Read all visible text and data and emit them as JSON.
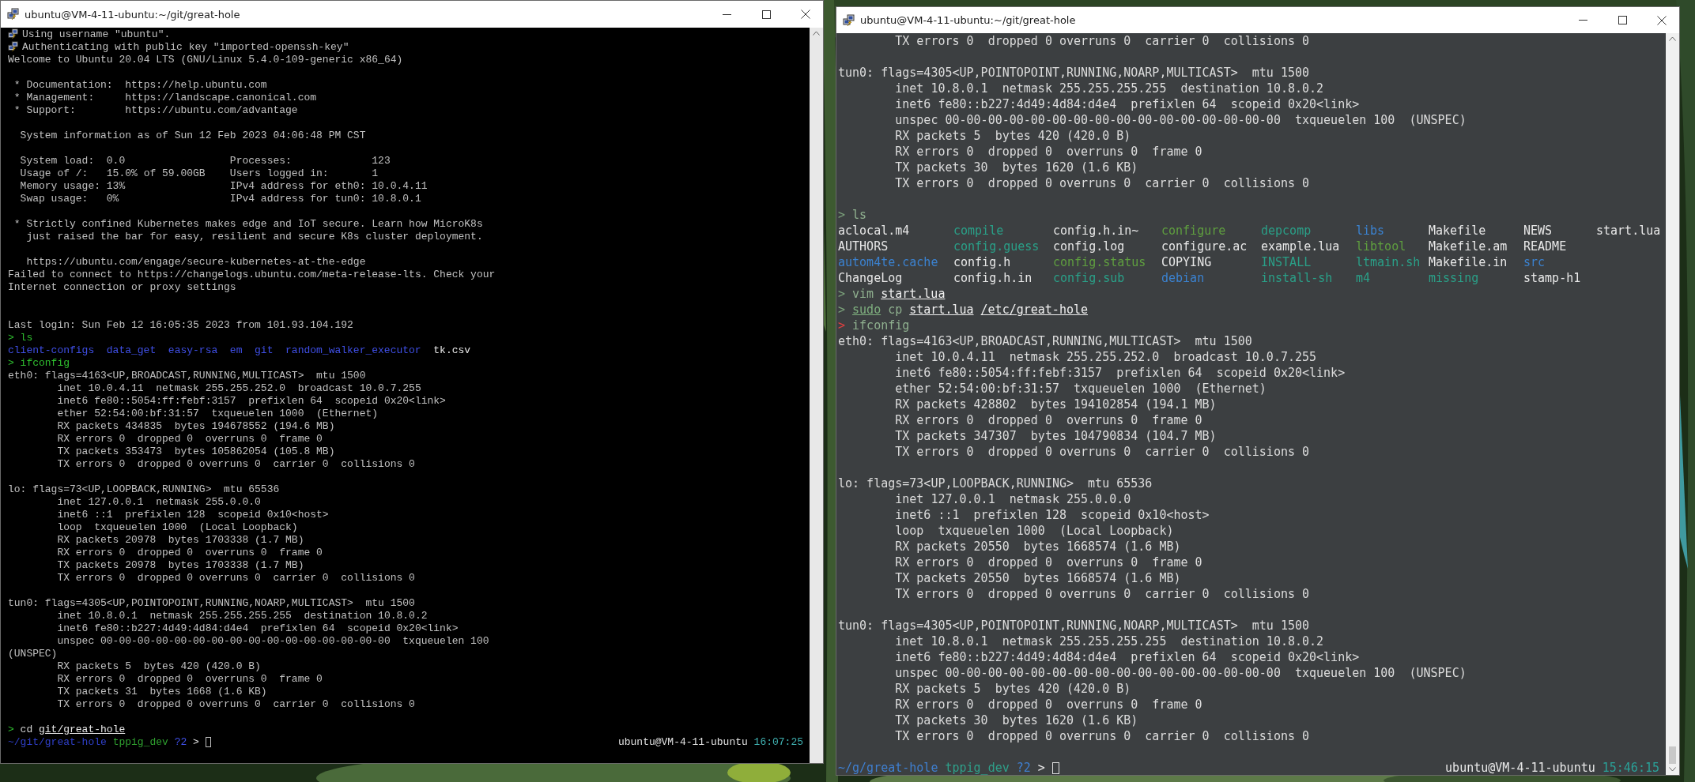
{
  "windows": [
    {
      "title": "ubuntu@VM-4-11-ubuntu:~/git/great-hole",
      "kind": "classic",
      "lines": [
        {
          "kind": "notice",
          "text": "Using username \"ubuntu\"."
        },
        {
          "kind": "notice",
          "text": "Authenticating with public key \"imported-openssh-key\""
        },
        {
          "kind": "output",
          "text": "Welcome to Ubuntu 20.04 LTS (GNU/Linux 5.4.0-109-generic x86_64)"
        },
        {
          "kind": "blank"
        },
        {
          "kind": "output",
          "text": " * Documentation:  https://help.ubuntu.com"
        },
        {
          "kind": "output",
          "text": " * Management:     https://landscape.canonical.com"
        },
        {
          "kind": "output",
          "text": " * Support:        https://ubuntu.com/advantage"
        },
        {
          "kind": "blank"
        },
        {
          "kind": "output",
          "text": "  System information as of Sun 12 Feb 2023 04:06:48 PM CST"
        },
        {
          "kind": "blank"
        },
        {
          "kind": "output",
          "text": "  System load:  0.0                 Processes:             123"
        },
        {
          "kind": "output",
          "text": "  Usage of /:   15.0% of 59.00GB    Users logged in:       1"
        },
        {
          "kind": "output",
          "text": "  Memory usage: 13%                 IPv4 address for eth0: 10.0.4.11"
        },
        {
          "kind": "output",
          "text": "  Swap usage:   0%                  IPv4 address for tun0: 10.8.0.1"
        },
        {
          "kind": "blank"
        },
        {
          "kind": "output",
          "text": " * Strictly confined Kubernetes makes edge and IoT secure. Learn how MicroK8s"
        },
        {
          "kind": "output",
          "text": "   just raised the bar for easy, resilient and secure K8s cluster deployment."
        },
        {
          "kind": "blank"
        },
        {
          "kind": "output",
          "text": "   https://ubuntu.com/engage/secure-kubernetes-at-the-edge"
        },
        {
          "kind": "output",
          "text": "Failed to connect to https://changelogs.ubuntu.com/meta-release-lts. Check your"
        },
        {
          "kind": "output",
          "text": "Internet connection or proxy settings"
        },
        {
          "kind": "blank"
        },
        {
          "kind": "blank"
        },
        {
          "kind": "output",
          "text": "Last login: Sun Feb 12 16:05:35 2023 from 101.93.104.192"
        },
        {
          "kind": "command",
          "segments": [
            {
              "text": ">",
              "kind": "prompt"
            },
            {
              "text": "ls",
              "kind": "command"
            }
          ]
        },
        {
          "kind": "ls-inline",
          "entries": [
            {
              "text": "client-configs",
              "kind": "dir"
            },
            {
              "text": "data_get",
              "kind": "dir"
            },
            {
              "text": "easy-rsa",
              "kind": "dir"
            },
            {
              "text": "em",
              "kind": "dir"
            },
            {
              "text": "git",
              "kind": "dir"
            },
            {
              "text": "random_walker_executor",
              "kind": "dir"
            },
            {
              "text": "tk.csv",
              "kind": "file"
            }
          ]
        },
        {
          "kind": "command",
          "segments": [
            {
              "text": ">",
              "kind": "prompt"
            },
            {
              "text": "ifconfig",
              "kind": "command"
            }
          ]
        },
        {
          "kind": "output",
          "text": "eth0: flags=4163<UP,BROADCAST,RUNNING,MULTICAST>  mtu 1500"
        },
        {
          "kind": "output",
          "text": "        inet 10.0.4.11  netmask 255.255.252.0  broadcast 10.0.7.255"
        },
        {
          "kind": "output",
          "text": "        inet6 fe80::5054:ff:febf:3157  prefixlen 64  scopeid 0x20<link>"
        },
        {
          "kind": "output",
          "text": "        ether 52:54:00:bf:31:57  txqueuelen 1000  (Ethernet)"
        },
        {
          "kind": "output",
          "text": "        RX packets 434835  bytes 194678552 (194.6 MB)"
        },
        {
          "kind": "output",
          "text": "        RX errors 0  dropped 0  overruns 0  frame 0"
        },
        {
          "kind": "output",
          "text": "        TX packets 353473  bytes 105862054 (105.8 MB)"
        },
        {
          "kind": "output",
          "text": "        TX errors 0  dropped 0 overruns 0  carrier 0  collisions 0"
        },
        {
          "kind": "blank"
        },
        {
          "kind": "output",
          "text": "lo: flags=73<UP,LOOPBACK,RUNNING>  mtu 65536"
        },
        {
          "kind": "output",
          "text": "        inet 127.0.0.1  netmask 255.0.0.0"
        },
        {
          "kind": "output",
          "text": "        inet6 ::1  prefixlen 128  scopeid 0x10<host>"
        },
        {
          "kind": "output",
          "text": "        loop  txqueuelen 1000  (Local Loopback)"
        },
        {
          "kind": "output",
          "text": "        RX packets 20978  bytes 1703338 (1.7 MB)"
        },
        {
          "kind": "output",
          "text": "        RX errors 0  dropped 0  overruns 0  frame 0"
        },
        {
          "kind": "output",
          "text": "        TX packets 20978  bytes 1703338 (1.7 MB)"
        },
        {
          "kind": "output",
          "text": "        TX errors 0  dropped 0 overruns 0  carrier 0  collisions 0"
        },
        {
          "kind": "blank"
        },
        {
          "kind": "output",
          "text": "tun0: flags=4305<UP,POINTOPOINT,RUNNING,NOARP,MULTICAST>  mtu 1500"
        },
        {
          "kind": "output",
          "text": "        inet 10.8.0.1  netmask 255.255.255.255  destination 10.8.0.2"
        },
        {
          "kind": "output",
          "text": "        inet6 fe80::b227:4d49:4d84:d4e4  prefixlen 64  scopeid 0x20<link>"
        },
        {
          "kind": "output",
          "text": "        unspec 00-00-00-00-00-00-00-00-00-00-00-00-00-00-00-00  txqueuelen 100"
        },
        {
          "kind": "output",
          "text": "(UNSPEC)"
        },
        {
          "kind": "output",
          "text": "        RX packets 5  bytes 420 (420.0 B)"
        },
        {
          "kind": "output",
          "text": "        RX errors 0  dropped 0  overruns 0  frame 0"
        },
        {
          "kind": "output",
          "text": "        TX packets 31  bytes 1668 (1.6 KB)"
        },
        {
          "kind": "output",
          "text": "        TX errors 0  dropped 0 overruns 0  carrier 0  collisions 0"
        },
        {
          "kind": "blank"
        },
        {
          "kind": "command",
          "segments": [
            {
              "text": ">",
              "kind": "prompt"
            },
            {
              "text": "cd",
              "kind": "builtin"
            },
            {
              "text": "git/great-hole",
              "kind": "path"
            }
          ]
        },
        {
          "kind": "prompt",
          "left": [
            {
              "text": "~/git/great-hole",
              "kind": "cwd"
            },
            {
              "text": "tppig_dev",
              "kind": "branch"
            },
            {
              "text": "?2",
              "kind": "status"
            },
            {
              "text": ">",
              "kind": "symbol"
            }
          ],
          "right": [
            {
              "text": "ubuntu@VM-4-11-ubuntu",
              "kind": "host"
            },
            {
              "text": "16:07:25",
              "kind": "time"
            }
          ]
        }
      ]
    },
    {
      "title": "ubuntu@VM-4-11-ubuntu:~/git/great-hole",
      "kind": "dark",
      "lines": [
        {
          "kind": "output",
          "text": "        TX errors 0  dropped 0 overruns 0  carrier 0  collisions 0"
        },
        {
          "kind": "blank"
        },
        {
          "kind": "output",
          "text": "tun0: flags=4305<UP,POINTOPOINT,RUNNING,NOARP,MULTICAST>  mtu 1500"
        },
        {
          "kind": "output",
          "text": "        inet 10.8.0.1  netmask 255.255.255.255  destination 10.8.0.2"
        },
        {
          "kind": "output",
          "text": "        inet6 fe80::b227:4d49:4d84:d4e4  prefixlen 64  scopeid 0x20<link>"
        },
        {
          "kind": "output",
          "text": "        unspec 00-00-00-00-00-00-00-00-00-00-00-00-00-00-00-00  txqueuelen 100  (UNSPEC)"
        },
        {
          "kind": "output",
          "text": "        RX packets 5  bytes 420 (420.0 B)"
        },
        {
          "kind": "output",
          "text": "        RX errors 0  dropped 0  overruns 0  frame 0"
        },
        {
          "kind": "output",
          "text": "        TX packets 30  bytes 1620 (1.6 KB)"
        },
        {
          "kind": "output",
          "text": "        TX errors 0  dropped 0 overruns 0  carrier 0  collisions 0"
        },
        {
          "kind": "blank"
        },
        {
          "kind": "command",
          "segments": [
            {
              "text": ">",
              "kind": "prompt"
            },
            {
              "text": "ls",
              "kind": "command"
            }
          ]
        },
        {
          "kind": "ls-grid",
          "rows": [
            [
              {
                "text": "aclocal.m4",
                "kind": "file"
              },
              {
                "text": "compile",
                "kind": "exec"
              },
              {
                "text": "config.h.in~",
                "kind": "file"
              },
              {
                "text": "configure",
                "kind": "script"
              },
              {
                "text": "depcomp",
                "kind": "exec"
              },
              {
                "text": "libs",
                "kind": "dir"
              },
              {
                "text": "Makefile",
                "kind": "file"
              },
              {
                "text": "NEWS",
                "kind": "file"
              },
              {
                "text": "start.lua",
                "kind": "file"
              }
            ],
            [
              {
                "text": "AUTHORS",
                "kind": "file"
              },
              {
                "text": "config.guess",
                "kind": "exec"
              },
              {
                "text": "config.log",
                "kind": "file"
              },
              {
                "text": "configure.ac",
                "kind": "file"
              },
              {
                "text": "example.lua",
                "kind": "file"
              },
              {
                "text": "libtool",
                "kind": "script"
              },
              {
                "text": "Makefile.am",
                "kind": "file"
              },
              {
                "text": "README",
                "kind": "file"
              }
            ],
            [
              {
                "text": "autom4te.cache",
                "kind": "dir"
              },
              {
                "text": "config.h",
                "kind": "file"
              },
              {
                "text": "config.status",
                "kind": "script"
              },
              {
                "text": "COPYING",
                "kind": "file"
              },
              {
                "text": "INSTALL",
                "kind": "exec"
              },
              {
                "text": "ltmain.sh",
                "kind": "exec"
              },
              {
                "text": "Makefile.in",
                "kind": "file"
              },
              {
                "text": "src",
                "kind": "dir"
              }
            ],
            [
              {
                "text": "ChangeLog",
                "kind": "file"
              },
              {
                "text": "config.h.in",
                "kind": "file"
              },
              {
                "text": "config.sub",
                "kind": "exec"
              },
              {
                "text": "debian",
                "kind": "dir"
              },
              {
                "text": "install-sh",
                "kind": "exec"
              },
              {
                "text": "m4",
                "kind": "exec"
              },
              {
                "text": "missing",
                "kind": "exec"
              },
              {
                "text": "stamp-h1",
                "kind": "file"
              }
            ]
          ]
        },
        {
          "kind": "command",
          "segments": [
            {
              "text": ">",
              "kind": "prompt"
            },
            {
              "text": "vim",
              "kind": "command"
            },
            {
              "text": "start.lua",
              "kind": "path"
            }
          ]
        },
        {
          "kind": "command",
          "segments": [
            {
              "text": ">",
              "kind": "prompt"
            },
            {
              "text": "sudo",
              "kind": "command-found"
            },
            {
              "text": "cp",
              "kind": "command"
            },
            {
              "text": "start.lua",
              "kind": "path"
            },
            {
              "text": "/etc/great-hole",
              "kind": "path"
            }
          ]
        },
        {
          "kind": "command",
          "segments": [
            {
              "text": ">",
              "kind": "prompt-error"
            },
            {
              "text": "ifconfig",
              "kind": "command"
            }
          ]
        },
        {
          "kind": "output",
          "text": "eth0: flags=4163<UP,BROADCAST,RUNNING,MULTICAST>  mtu 1500"
        },
        {
          "kind": "output",
          "text": "        inet 10.0.4.11  netmask 255.255.252.0  broadcast 10.0.7.255"
        },
        {
          "kind": "output",
          "text": "        inet6 fe80::5054:ff:febf:3157  prefixlen 64  scopeid 0x20<link>"
        },
        {
          "kind": "output",
          "text": "        ether 52:54:00:bf:31:57  txqueuelen 1000  (Ethernet)"
        },
        {
          "kind": "output",
          "text": "        RX packets 428802  bytes 194102854 (194.1 MB)"
        },
        {
          "kind": "output",
          "text": "        RX errors 0  dropped 0  overruns 0  frame 0"
        },
        {
          "kind": "output",
          "text": "        TX packets 347307  bytes 104790834 (104.7 MB)"
        },
        {
          "kind": "output",
          "text": "        TX errors 0  dropped 0 overruns 0  carrier 0  collisions 0"
        },
        {
          "kind": "blank"
        },
        {
          "kind": "output",
          "text": "lo: flags=73<UP,LOOPBACK,RUNNING>  mtu 65536"
        },
        {
          "kind": "output",
          "text": "        inet 127.0.0.1  netmask 255.0.0.0"
        },
        {
          "kind": "output",
          "text": "        inet6 ::1  prefixlen 128  scopeid 0x10<host>"
        },
        {
          "kind": "output",
          "text": "        loop  txqueuelen 1000  (Local Loopback)"
        },
        {
          "kind": "output",
          "text": "        RX packets 20550  bytes 1668574 (1.6 MB)"
        },
        {
          "kind": "output",
          "text": "        RX errors 0  dropped 0  overruns 0  frame 0"
        },
        {
          "kind": "output",
          "text": "        TX packets 20550  bytes 1668574 (1.6 MB)"
        },
        {
          "kind": "output",
          "text": "        TX errors 0  dropped 0 overruns 0  carrier 0  collisions 0"
        },
        {
          "kind": "blank"
        },
        {
          "kind": "output",
          "text": "tun0: flags=4305<UP,POINTOPOINT,RUNNING,NOARP,MULTICAST>  mtu 1500"
        },
        {
          "kind": "output",
          "text": "        inet 10.8.0.1  netmask 255.255.255.255  destination 10.8.0.2"
        },
        {
          "kind": "output",
          "text": "        inet6 fe80::b227:4d49:4d84:d4e4  prefixlen 64  scopeid 0x20<link>"
        },
        {
          "kind": "output",
          "text": "        unspec 00-00-00-00-00-00-00-00-00-00-00-00-00-00-00-00  txqueuelen 100  (UNSPEC)"
        },
        {
          "kind": "output",
          "text": "        RX packets 5  bytes 420 (420.0 B)"
        },
        {
          "kind": "output",
          "text": "        RX errors 0  dropped 0  overruns 0  frame 0"
        },
        {
          "kind": "output",
          "text": "        TX packets 30  bytes 1620 (1.6 KB)"
        },
        {
          "kind": "output",
          "text": "        TX errors 0  dropped 0 overruns 0  carrier 0  collisions 0"
        },
        {
          "kind": "blank"
        },
        {
          "kind": "prompt",
          "left": [
            {
              "text": "~/g/great-hole",
              "kind": "cwd"
            },
            {
              "text": "tppig_dev",
              "kind": "branch"
            },
            {
              "text": "?2",
              "kind": "status"
            },
            {
              "text": ">",
              "kind": "symbol"
            }
          ],
          "right": [
            {
              "text": "ubuntu@VM-4-11-ubuntu",
              "kind": "host"
            },
            {
              "text": "15:46:15",
              "kind": "time"
            }
          ]
        }
      ]
    }
  ]
}
